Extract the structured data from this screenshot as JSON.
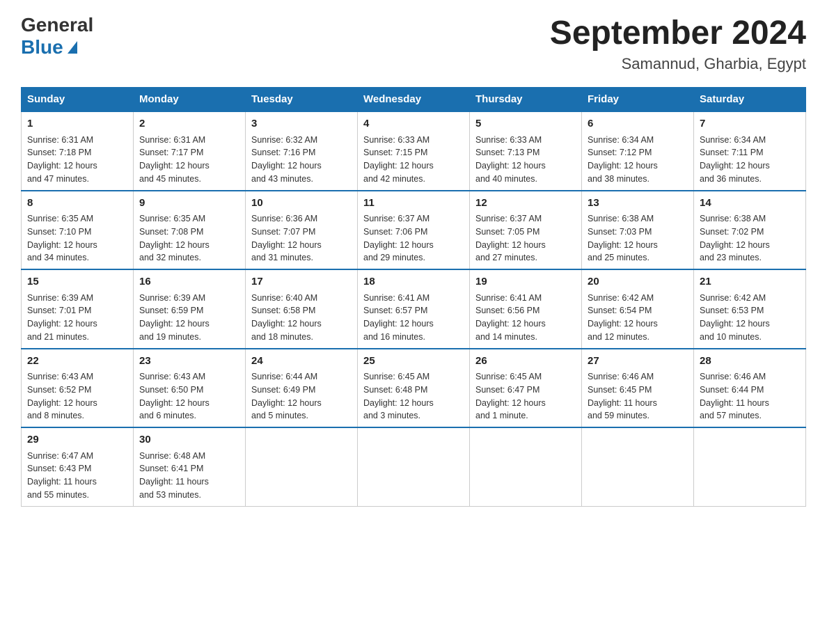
{
  "logo": {
    "general": "General",
    "blue": "Blue"
  },
  "title": {
    "month_year": "September 2024",
    "location": "Samannud, Gharbia, Egypt"
  },
  "days_of_week": [
    "Sunday",
    "Monday",
    "Tuesday",
    "Wednesday",
    "Thursday",
    "Friday",
    "Saturday"
  ],
  "weeks": [
    [
      {
        "day": "1",
        "sunrise": "6:31 AM",
        "sunset": "7:18 PM",
        "daylight": "12 hours and 47 minutes."
      },
      {
        "day": "2",
        "sunrise": "6:31 AM",
        "sunset": "7:17 PM",
        "daylight": "12 hours and 45 minutes."
      },
      {
        "day": "3",
        "sunrise": "6:32 AM",
        "sunset": "7:16 PM",
        "daylight": "12 hours and 43 minutes."
      },
      {
        "day": "4",
        "sunrise": "6:33 AM",
        "sunset": "7:15 PM",
        "daylight": "12 hours and 42 minutes."
      },
      {
        "day": "5",
        "sunrise": "6:33 AM",
        "sunset": "7:13 PM",
        "daylight": "12 hours and 40 minutes."
      },
      {
        "day": "6",
        "sunrise": "6:34 AM",
        "sunset": "7:12 PM",
        "daylight": "12 hours and 38 minutes."
      },
      {
        "day": "7",
        "sunrise": "6:34 AM",
        "sunset": "7:11 PM",
        "daylight": "12 hours and 36 minutes."
      }
    ],
    [
      {
        "day": "8",
        "sunrise": "6:35 AM",
        "sunset": "7:10 PM",
        "daylight": "12 hours and 34 minutes."
      },
      {
        "day": "9",
        "sunrise": "6:35 AM",
        "sunset": "7:08 PM",
        "daylight": "12 hours and 32 minutes."
      },
      {
        "day": "10",
        "sunrise": "6:36 AM",
        "sunset": "7:07 PM",
        "daylight": "12 hours and 31 minutes."
      },
      {
        "day": "11",
        "sunrise": "6:37 AM",
        "sunset": "7:06 PM",
        "daylight": "12 hours and 29 minutes."
      },
      {
        "day": "12",
        "sunrise": "6:37 AM",
        "sunset": "7:05 PM",
        "daylight": "12 hours and 27 minutes."
      },
      {
        "day": "13",
        "sunrise": "6:38 AM",
        "sunset": "7:03 PM",
        "daylight": "12 hours and 25 minutes."
      },
      {
        "day": "14",
        "sunrise": "6:38 AM",
        "sunset": "7:02 PM",
        "daylight": "12 hours and 23 minutes."
      }
    ],
    [
      {
        "day": "15",
        "sunrise": "6:39 AM",
        "sunset": "7:01 PM",
        "daylight": "12 hours and 21 minutes."
      },
      {
        "day": "16",
        "sunrise": "6:39 AM",
        "sunset": "6:59 PM",
        "daylight": "12 hours and 19 minutes."
      },
      {
        "day": "17",
        "sunrise": "6:40 AM",
        "sunset": "6:58 PM",
        "daylight": "12 hours and 18 minutes."
      },
      {
        "day": "18",
        "sunrise": "6:41 AM",
        "sunset": "6:57 PM",
        "daylight": "12 hours and 16 minutes."
      },
      {
        "day": "19",
        "sunrise": "6:41 AM",
        "sunset": "6:56 PM",
        "daylight": "12 hours and 14 minutes."
      },
      {
        "day": "20",
        "sunrise": "6:42 AM",
        "sunset": "6:54 PM",
        "daylight": "12 hours and 12 minutes."
      },
      {
        "day": "21",
        "sunrise": "6:42 AM",
        "sunset": "6:53 PM",
        "daylight": "12 hours and 10 minutes."
      }
    ],
    [
      {
        "day": "22",
        "sunrise": "6:43 AM",
        "sunset": "6:52 PM",
        "daylight": "12 hours and 8 minutes."
      },
      {
        "day": "23",
        "sunrise": "6:43 AM",
        "sunset": "6:50 PM",
        "daylight": "12 hours and 6 minutes."
      },
      {
        "day": "24",
        "sunrise": "6:44 AM",
        "sunset": "6:49 PM",
        "daylight": "12 hours and 5 minutes."
      },
      {
        "day": "25",
        "sunrise": "6:45 AM",
        "sunset": "6:48 PM",
        "daylight": "12 hours and 3 minutes."
      },
      {
        "day": "26",
        "sunrise": "6:45 AM",
        "sunset": "6:47 PM",
        "daylight": "12 hours and 1 minute."
      },
      {
        "day": "27",
        "sunrise": "6:46 AM",
        "sunset": "6:45 PM",
        "daylight": "11 hours and 59 minutes."
      },
      {
        "day": "28",
        "sunrise": "6:46 AM",
        "sunset": "6:44 PM",
        "daylight": "11 hours and 57 minutes."
      }
    ],
    [
      {
        "day": "29",
        "sunrise": "6:47 AM",
        "sunset": "6:43 PM",
        "daylight": "11 hours and 55 minutes."
      },
      {
        "day": "30",
        "sunrise": "6:48 AM",
        "sunset": "6:41 PM",
        "daylight": "11 hours and 53 minutes."
      },
      null,
      null,
      null,
      null,
      null
    ]
  ],
  "labels": {
    "sunrise": "Sunrise:",
    "sunset": "Sunset:",
    "daylight": "Daylight:"
  }
}
